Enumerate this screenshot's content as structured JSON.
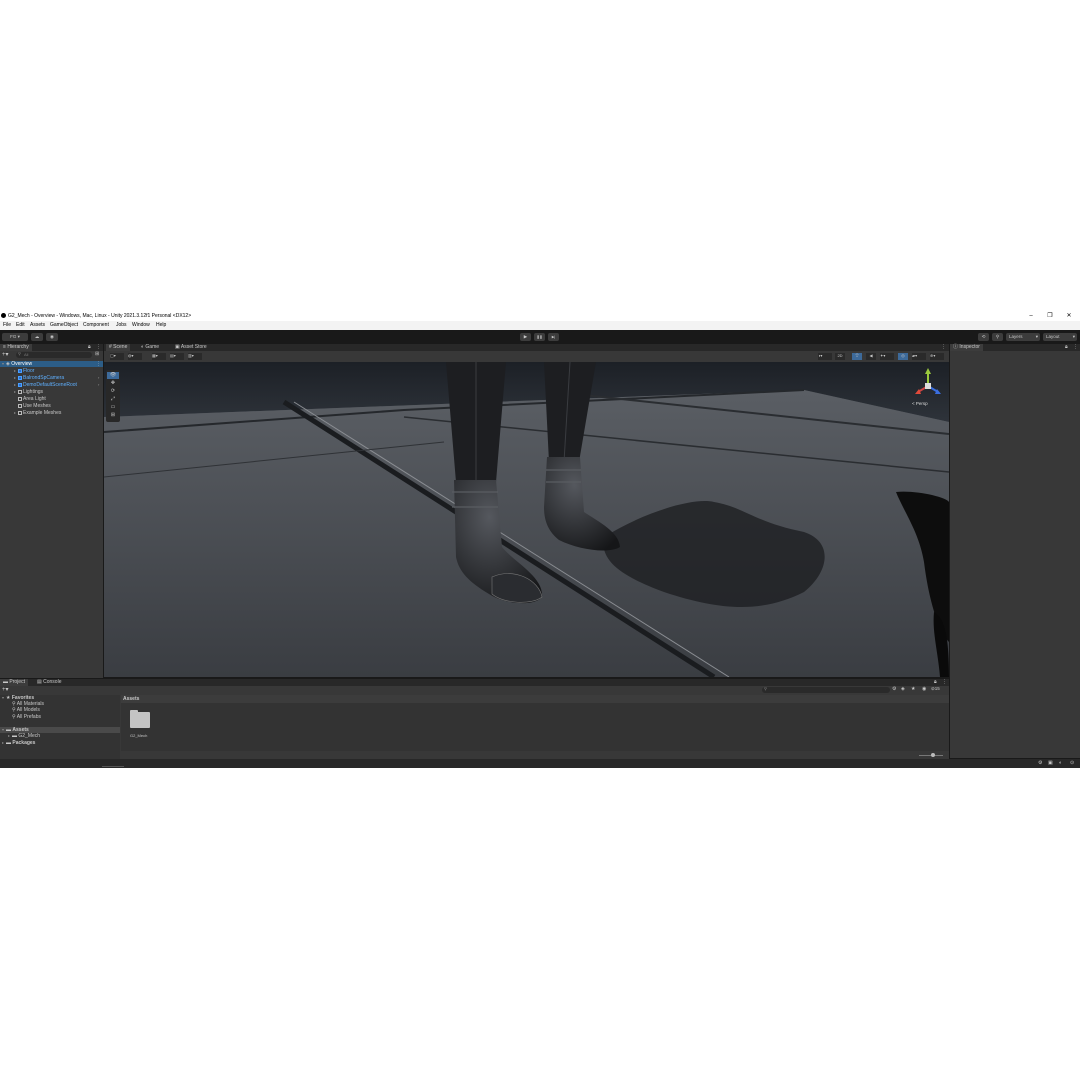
{
  "window": {
    "title": "G2_Mech - Overview - Windows, Mac, Linux - Unity 2021.3.12f1 Personal <DX12>",
    "controls": {
      "minimize": "–",
      "maximize": "❐",
      "close": "✕"
    }
  },
  "menubar": [
    "File",
    "Edit",
    "Assets",
    "GameObject",
    "Component",
    "Jobs",
    "Window",
    "Help"
  ],
  "toolbar": {
    "account": "FG",
    "play_icon": "▶",
    "pause_icon": "❚❚",
    "step_icon": "▶|",
    "layers": "Layers",
    "layout": "Layout"
  },
  "hierarchy": {
    "tab": "Hierarchy",
    "search_placeholder": "All",
    "scene_name": "Overview",
    "items": [
      {
        "label": "Floor",
        "prefab": true
      },
      {
        "label": "BalrondSpCamera",
        "prefab": true
      },
      {
        "label": "DemoDefaultSceneRoot",
        "prefab": true
      },
      {
        "label": "Lightings",
        "prefab": false
      },
      {
        "label": "Area Light",
        "prefab": false
      },
      {
        "label": "Use Meshes",
        "prefab": false
      },
      {
        "label": "Example Meshes",
        "prefab": false
      }
    ]
  },
  "scene_view": {
    "tabs": [
      "Scene",
      "Game",
      "Asset Store"
    ],
    "active_tab": "Scene",
    "gizmo_label": "< Persp",
    "mode_2d": "2D"
  },
  "inspector": {
    "tab": "Inspector"
  },
  "project": {
    "tabs": [
      "Project",
      "Console"
    ],
    "favorites_label": "Favorites",
    "favorites": [
      "All Materials",
      "All Models",
      "All Prefabs"
    ],
    "tree": [
      {
        "label": "Assets",
        "bold": true
      },
      {
        "label": "G2_Mech",
        "bold": false
      },
      {
        "label": "Packages",
        "bold": true
      }
    ],
    "breadcrumb": "Assets",
    "assets": [
      {
        "name": "G2_Mech",
        "icon": "folder-icon"
      }
    ],
    "hidden_count": "15"
  },
  "colors": {
    "accent": "#2c5d87",
    "prefab_blue": "#5fb0ff",
    "panel_bg": "#383838",
    "tab_bg": "#282828"
  }
}
